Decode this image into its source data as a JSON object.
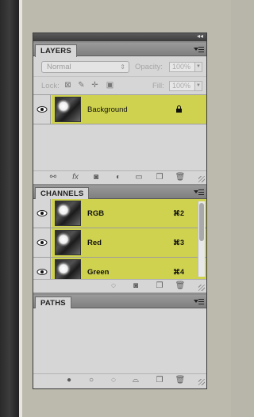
{
  "layers_panel": {
    "tab": "LAYERS",
    "blend_mode": "Normal",
    "opacity_label": "Opacity:",
    "opacity_value": "100%",
    "lock_label": "Lock:",
    "fill_label": "Fill:",
    "fill_value": "100%",
    "layers": [
      {
        "name": "Background",
        "locked": true,
        "visible": true,
        "selected": true
      }
    ],
    "bottom_icons": [
      "link-icon",
      "fx-icon",
      "mask-icon",
      "adjustment-icon",
      "folder-icon",
      "new-layer-icon",
      "trash-icon"
    ]
  },
  "channels_panel": {
    "tab": "CHANNELS",
    "channels": [
      {
        "name": "RGB",
        "shortcut": "⌘2"
      },
      {
        "name": "Red",
        "shortcut": "⌘3"
      },
      {
        "name": "Green",
        "shortcut": "⌘4"
      }
    ],
    "bottom_icons": [
      "load-selection-icon",
      "save-selection-icon",
      "new-channel-icon",
      "trash-icon"
    ]
  },
  "paths_panel": {
    "tab": "PATHS",
    "bottom_icons": [
      "fill-path-icon",
      "stroke-path-icon",
      "path-to-selection-icon",
      "selection-to-path-icon",
      "new-path-icon",
      "trash-icon"
    ]
  },
  "colors": {
    "highlight": "#cfd24e",
    "panel_bg": "#d6d6d6"
  }
}
